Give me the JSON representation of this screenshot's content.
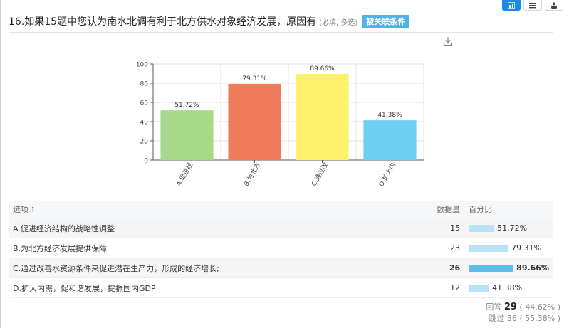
{
  "question": {
    "title": "16.如果15题中您认为南水北调有利于北方供水对象经济发展，原因有",
    "hint": "(必填, 多选)",
    "tag": "被关联条件"
  },
  "chart_data": {
    "type": "bar",
    "categories": [
      "A.促进经",
      "B.为北方",
      "C.通过改",
      "D.扩大内"
    ],
    "values": [
      51.72,
      79.31,
      89.66,
      41.38
    ],
    "value_labels": [
      "51.72%",
      "79.31%",
      "89.66%",
      "41.38%"
    ],
    "colors": [
      "#a8d98a",
      "#f07b5a",
      "#fdf06b",
      "#6dd0f2"
    ],
    "ylim": [
      0,
      100
    ],
    "yticks": [
      0,
      20,
      40,
      60,
      80,
      100
    ],
    "grid": true
  },
  "table": {
    "headers": {
      "option": "选项",
      "count": "数据量",
      "percent": "百分比"
    },
    "rows": [
      {
        "option": "A.促进经济结构的战略性调整",
        "count": "15",
        "percent": "51.72%",
        "value": 0.5172
      },
      {
        "option": "B.为北方经济发展提供保障",
        "count": "23",
        "percent": "79.31%",
        "value": 0.7931
      },
      {
        "option": "C.通过改善水资源条件来促进潜在生产力，形成的经济增长;",
        "count": "26",
        "percent": "89.66%",
        "value": 0.8966
      },
      {
        "option": "D.扩大内需，促和谐发展，提振国内GDP",
        "count": "12",
        "percent": "41.38%",
        "value": 0.4138
      }
    ]
  },
  "footer": {
    "answered_label": "回答",
    "answered_count": "29",
    "answered_pct": "( 44.62% )",
    "skipped_label": "跳过",
    "skipped_count": "36",
    "skipped_pct": "( 55.38% )"
  },
  "icons": {
    "download": "download-icon",
    "view_chart": "bar-chart-icon",
    "view_list": "list-icon",
    "view_user": "user-icon"
  }
}
